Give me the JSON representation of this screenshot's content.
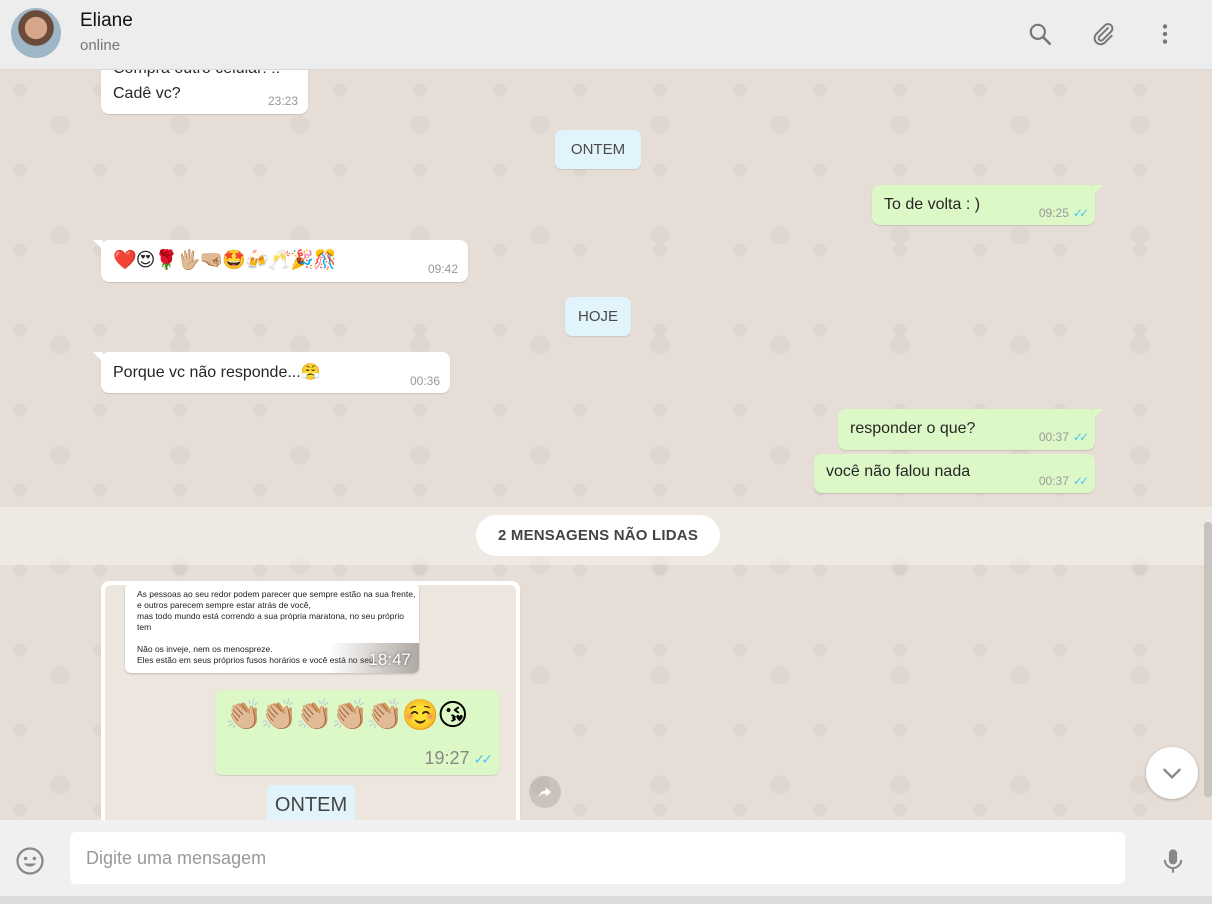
{
  "header": {
    "contact_name": "Eliane",
    "contact_status": "online",
    "icons": [
      "search-icon",
      "paperclip-icon",
      "more-vertical-icon"
    ]
  },
  "messages": [
    {
      "id": "m1",
      "direction": "in",
      "lines": [
        "Compra outro celular! !!",
        "Cadê vc?"
      ],
      "time": "23:23"
    },
    {
      "id": "day1",
      "type": "day",
      "label": "ONTEM"
    },
    {
      "id": "m2",
      "direction": "out",
      "text": "To de volta : )",
      "time": "09:25",
      "status": "read"
    },
    {
      "id": "m3",
      "direction": "in",
      "text": "❤️😍🌹🖐🏼🤜🏼🤩🍻🥂🎉🎊",
      "time": "09:42"
    },
    {
      "id": "day2",
      "type": "day",
      "label": "HOJE"
    },
    {
      "id": "m4",
      "direction": "in",
      "text": "Porque vc não responde...😤",
      "time": "00:36"
    },
    {
      "id": "m5",
      "direction": "out",
      "text": "responder o que?",
      "time": "00:37",
      "status": "read"
    },
    {
      "id": "m6",
      "direction": "out",
      "text": "você não falou  nada",
      "time": "00:37",
      "status": "read"
    }
  ],
  "unread_divider": "2 MENSAGENS NÃO LIDAS",
  "image_message": {
    "quote_text": "As pessoas ao seu redor podem parecer que sempre estão na sua frente,\ne outros parecem sempre estar atrás de você,\nmas todo mundo está correndo a sua própria maratona, no seu próprio tem\n\nNão os inveje, nem os menospreze.\nEles estão em seus próprios fusos horários e você está no seu.\n\nA vida é sobre como nós esperamos pelo momento certo para agir.",
    "quote_time": "18:47",
    "emoji_text": "👏🏼👏🏼👏🏼👏🏼👏🏼☺️😘",
    "emoji_time": "19:27",
    "day_label": "ONTEM"
  },
  "composer": {
    "placeholder": "Digite uma mensagem"
  },
  "colors": {
    "header_bg": "#ededed",
    "chat_bg": "#e6ded6",
    "bubble_in": "#ffffff",
    "bubble_out": "#dcf8c6",
    "day_chip": "#e1f3fb",
    "read_ticks": "#4fc3f7"
  }
}
